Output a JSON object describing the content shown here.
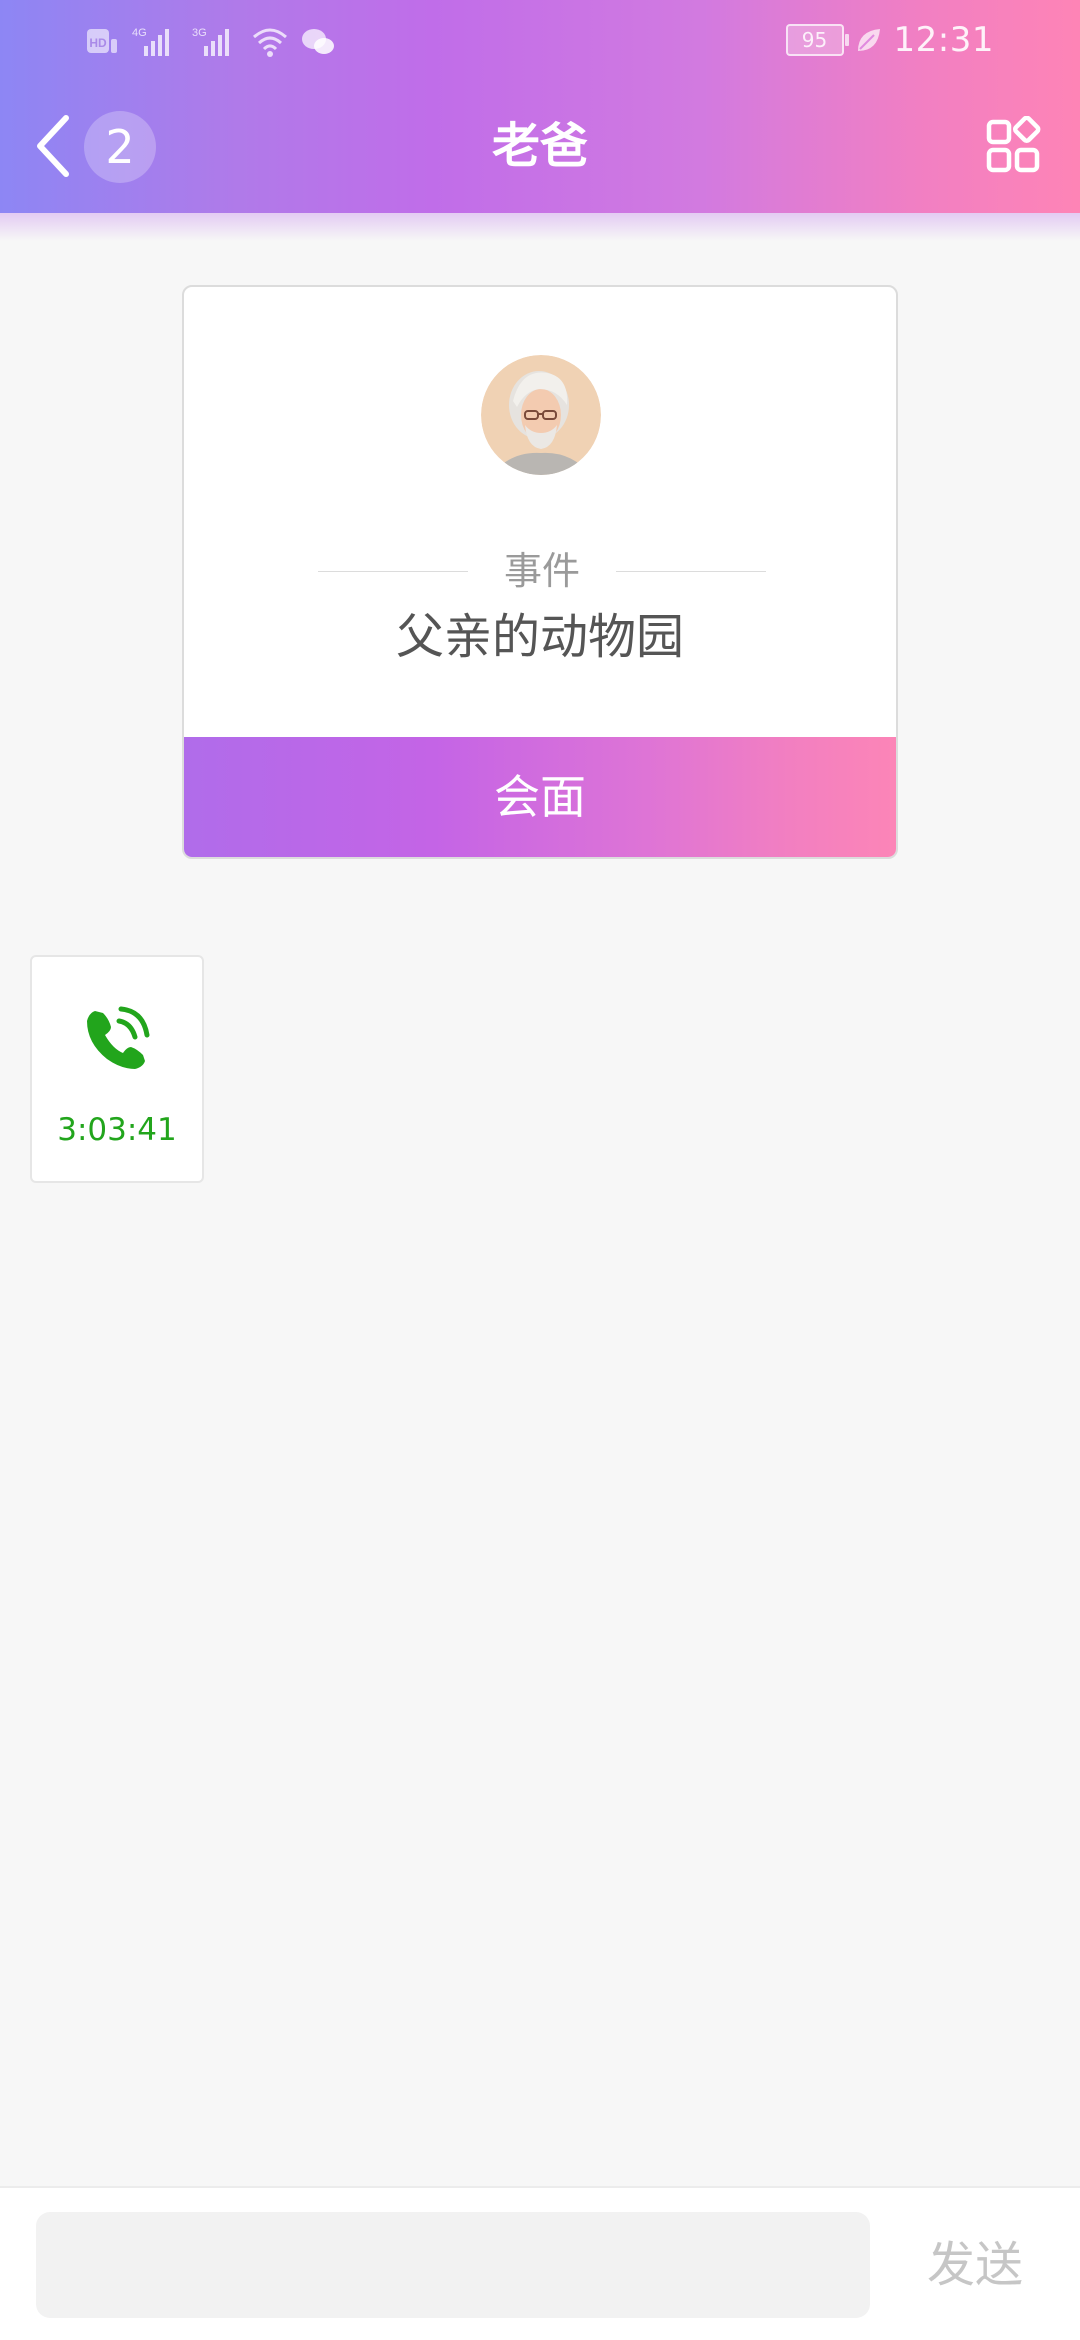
{
  "status_bar": {
    "left_icons": [
      "hd-icon",
      "signal-4g-icon",
      "signal-3g-icon",
      "wifi-icon",
      "wechat-icon"
    ],
    "network_4g_label": "4G",
    "network_3g_label": "3G",
    "hd_label": "HD",
    "battery_level": "95",
    "time": "12:31"
  },
  "header": {
    "unread_count": "2",
    "title": "老爸",
    "colors": {
      "gradient_start": "#8d86f4",
      "gradient_mid": "#c06de9",
      "gradient_end": "#fe84b6"
    }
  },
  "event_card": {
    "label": "事件",
    "event_name": "父亲的动物园",
    "action_label": "会面"
  },
  "messages": [
    {
      "type": "call",
      "icon": "phone-call-icon",
      "duration": "3:03:41",
      "color": "#22a51c"
    }
  ],
  "input_bar": {
    "input_value": "",
    "send_label": "发送"
  }
}
